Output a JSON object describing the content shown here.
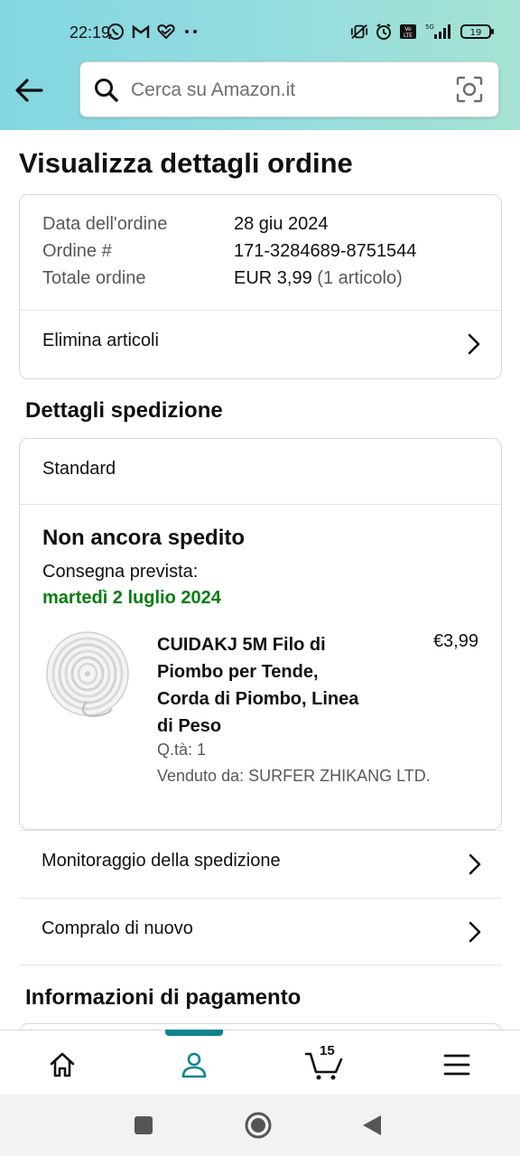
{
  "status_bar": {
    "time": "22:19",
    "left_icons": [
      "whatsapp-icon",
      "gmail-icon",
      "heart-app-icon",
      "more-dots-icon"
    ],
    "right_icons": [
      "vibrate-icon",
      "alarm-icon",
      "volte-icon",
      "signal-icon"
    ],
    "battery": "19"
  },
  "search": {
    "placeholder": "Cerca su Amazon.it"
  },
  "page": {
    "title": "Visualizza dettagli ordine"
  },
  "order": {
    "date_label": "Data dell'ordine",
    "date_value": "28 giu 2024",
    "number_label": "Ordine #",
    "number_value": "171-3284689-8751544",
    "total_label": "Totale ordine",
    "total_value": "EUR 3,99",
    "total_items": "(1 articolo)",
    "delete_items": "Elimina articoli"
  },
  "shipping": {
    "section_title": "Dettagli spedizione",
    "method": "Standard",
    "status": "Non ancora spedito",
    "delivery_label": "Consegna prevista:",
    "delivery_date": "martedì 2 luglio 2024",
    "product": {
      "name": "CUIDAKJ 5M Filo di Piombo per Tende, Corda di Piombo, Linea di Peso",
      "price": "€3,99",
      "qty": "Q.tà: 1",
      "seller": "Venduto da: SURFER ZHIKANG LTD."
    },
    "track": "Monitoraggio della spedizione",
    "buy_again": "Compralo di nuovo"
  },
  "payment": {
    "section_title": "Informazioni di pagamento"
  },
  "bottom_nav": {
    "items": [
      "home-icon",
      "account-icon",
      "cart-icon",
      "menu-icon"
    ],
    "active": "account-icon",
    "cart_count": "15"
  },
  "colors": {
    "header_gradient_start": "#83d7e0",
    "header_gradient_end": "#a5e3d3",
    "delivery_green": "#067d0f",
    "active_nav": "#10848c"
  }
}
